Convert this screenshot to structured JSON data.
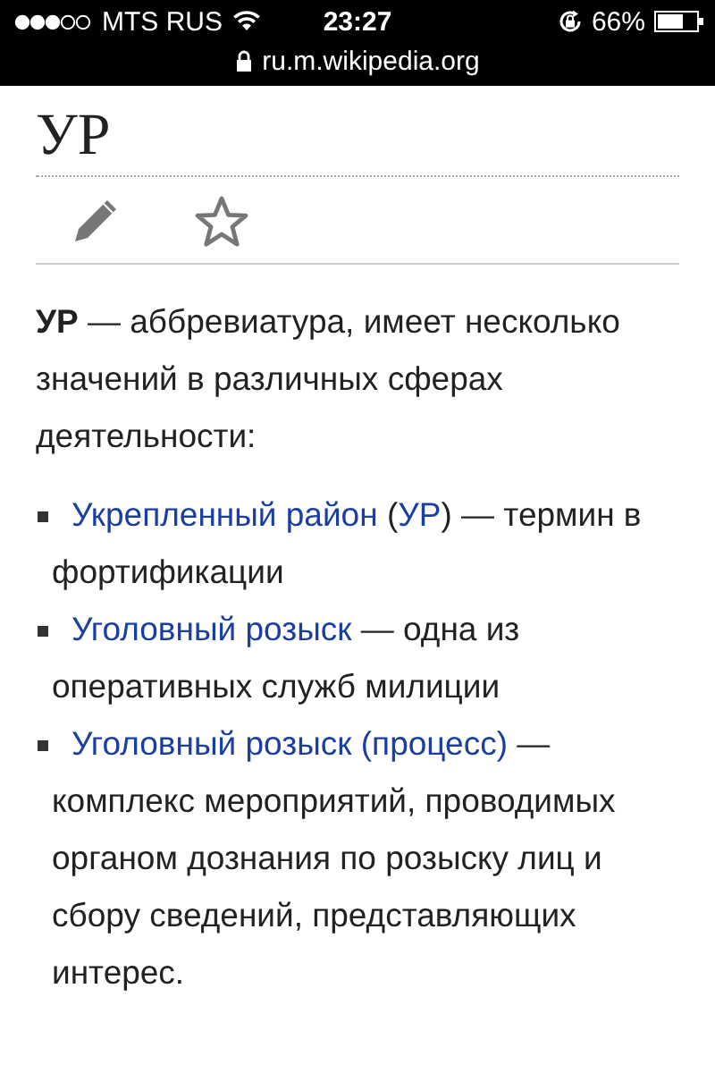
{
  "status_bar": {
    "carrier": "MTS RUS",
    "time": "23:27",
    "battery": "66%"
  },
  "address_bar": {
    "url": "ru.m.wikipedia.org"
  },
  "page": {
    "title": "УР",
    "intro": "**УР** — аббревиатура, имеет несколько значений в различных сферах деятельности:",
    "items": [
      {
        "parts": [
          {
            "kind": "link",
            "text": "Укрепленный район"
          },
          {
            "kind": "text",
            "text": " ("
          },
          {
            "kind": "link",
            "text": "УР"
          },
          {
            "kind": "text",
            "text": ") — термин в фортификации"
          }
        ]
      },
      {
        "parts": [
          {
            "kind": "link",
            "text": "Уголовный розыск"
          },
          {
            "kind": "text",
            "text": " — одна из оперативных служб милиции"
          }
        ]
      },
      {
        "parts": [
          {
            "kind": "link",
            "text": "Уголовный розыск (процесс)"
          },
          {
            "kind": "text",
            "text": " — комплекс мероприятий, проводимых органом дознания по розыску лиц и сбору сведений, представляющих интерес."
          }
        ]
      }
    ]
  }
}
